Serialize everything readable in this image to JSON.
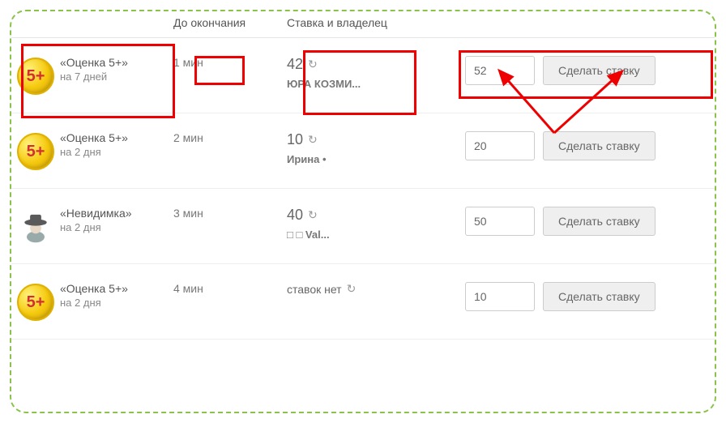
{
  "headers": {
    "time": "До окончания",
    "bid": "Ставка и владелец"
  },
  "button_label": "Сделать ставку",
  "medal_text": "5+",
  "icons": {
    "refresh": "↻"
  },
  "rows": [
    {
      "icon": "medal",
      "title": "«Оценка 5+»",
      "sub": "на 7 дней",
      "time": "1 мин",
      "bid_num": "42",
      "bid_owner": "ЮРА КОЗМИ...",
      "input": "52"
    },
    {
      "icon": "medal",
      "title": "«Оценка 5+»",
      "sub": "на 2 дня",
      "time": "2 мин",
      "bid_num": "10",
      "bid_owner": "Ирина •",
      "input": "20"
    },
    {
      "icon": "spy",
      "title": "«Невидимка»",
      "sub": "на 2 дня",
      "time": "3 мин",
      "bid_num": "40",
      "bid_owner": "□ □ Val...",
      "input": "50"
    },
    {
      "icon": "medal",
      "title": "«Оценка 5+»",
      "sub": "на 2 дня",
      "time": "4 мин",
      "bid_text": "ставок нет",
      "input": "10"
    }
  ]
}
